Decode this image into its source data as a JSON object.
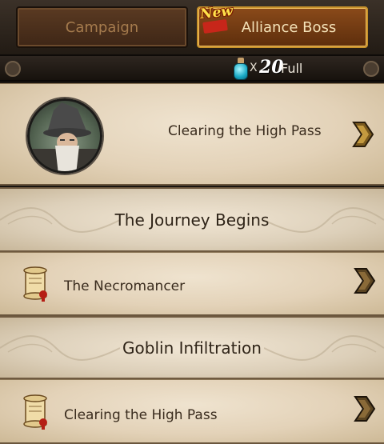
{
  "tabs": {
    "campaign_label": "Campaign",
    "alliance_boss_label": "Alliance Boss",
    "new_badge": "New",
    "active": "Alliance Boss"
  },
  "stamina": {
    "icon": "potion-icon",
    "multiplier": "X",
    "count": "20",
    "status": "Full"
  },
  "featured": {
    "avatar_icon": "wizard-portrait-icon",
    "label": "Clearing the High Pass",
    "arrow_icon": "chevron-right-icon"
  },
  "chapters": [
    {
      "title": "The Journey Begins",
      "quests": [
        {
          "icon": "scroll-icon",
          "label": "The Necromancer",
          "arrow_icon": "chevron-right-icon"
        }
      ]
    },
    {
      "title": "Goblin Infiltration",
      "quests": [
        {
          "icon": "scroll-icon",
          "label": "Clearing the High Pass",
          "arrow_icon": "chevron-right-icon"
        }
      ]
    }
  ],
  "colors": {
    "parchment": "#e3d2b8",
    "tab_active": "#8a4a1a",
    "tab_inactive": "#5a3a22",
    "text_dark": "#2f2418",
    "gold": "#c8922b"
  }
}
